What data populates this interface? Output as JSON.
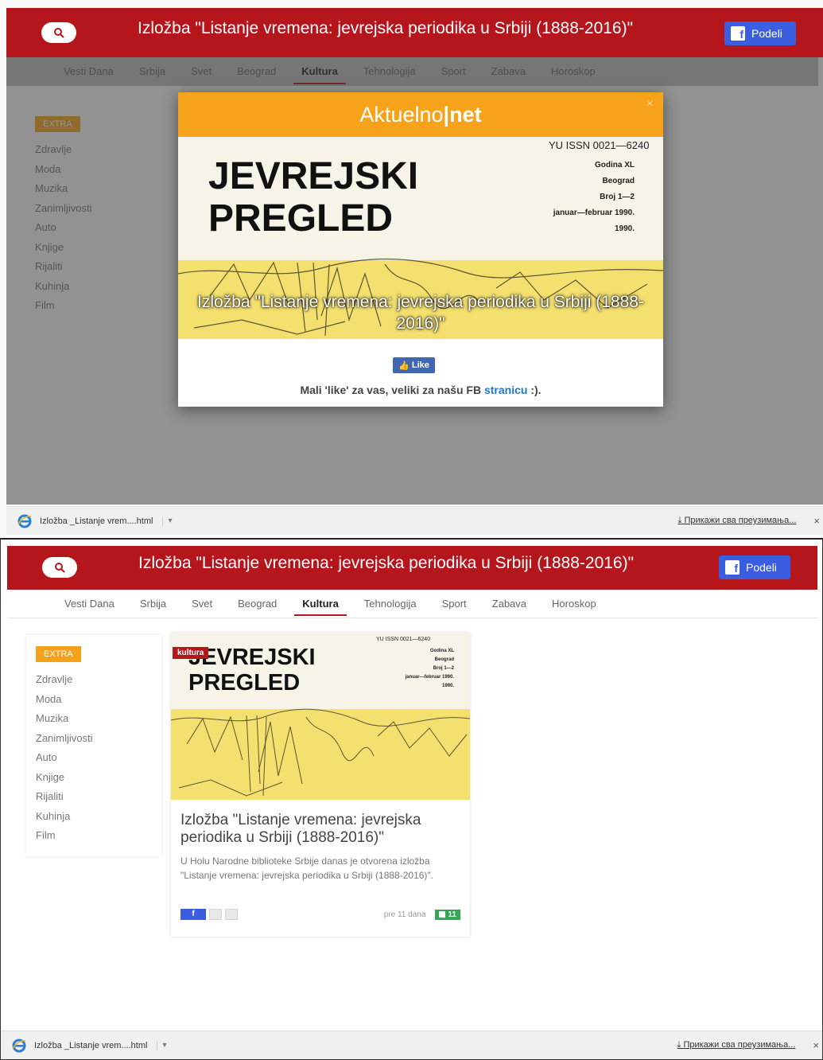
{
  "header": {
    "title": "Izložba \"Listanje vremena: jevrejska periodika u Srbiji (1888-2016)\"",
    "share_label": "Podeli"
  },
  "nav": {
    "items": [
      "Vesti Dana",
      "Srbija",
      "Svet",
      "Beograd",
      "Kultura",
      "Tehnologija",
      "Sport",
      "Zabava",
      "Horoskop"
    ],
    "active": "Kultura"
  },
  "sidebar": {
    "badge": "EXTRA",
    "items": [
      "Zdravlje",
      "Moda",
      "Muzika",
      "Zanimljivosti",
      "Auto",
      "Knjige",
      "Rijaliti",
      "Kuhinja",
      "Film"
    ]
  },
  "modal": {
    "brand_a": "Aktuelno",
    "brand_sep": "|",
    "brand_b": "net",
    "close": "×",
    "caption": "Izložba \"Listanje vremena: jevrejska periodika u Srbiji (1888-2016)\"",
    "like_label": "Like",
    "like_note_pre": "Mali 'like' za vas, veliki za našu FB ",
    "like_note_link": "stranicu",
    "like_note_post": " :)."
  },
  "cover": {
    "issn": "YU ISSN 0021—6240",
    "line1": "JEVREJSKI",
    "line2": "PREGLED",
    "meta": [
      "Godina XL",
      "Beograd",
      "Broj 1—2",
      "januar—februar 1990.",
      "1990."
    ]
  },
  "card": {
    "category": "kultura",
    "title": "Izložba \"Listanje vremena: jevrejska periodika u Srbiji (1888-2016)\"",
    "description": "U Holu Narodne biblioteke Srbije danas je otvorena izložba \"Listanje vremena: jevrejska periodika u Srbiji (1888-2016)\".",
    "fb_label": "f",
    "time_ago": "pre 11 dana",
    "count": "11"
  },
  "download_bar": {
    "file": "Izložba _Listanje vrem....html",
    "file_bottom": "Izložba _Listanje vrem....html",
    "caret": "▾",
    "show_all": "Прикажи сва преузимања...",
    "close": "×"
  },
  "colors": {
    "brand_red": "#b5161c",
    "accent_orange": "#f7a21b",
    "facebook_blue": "#3b5ee0",
    "count_green": "#35a853"
  }
}
